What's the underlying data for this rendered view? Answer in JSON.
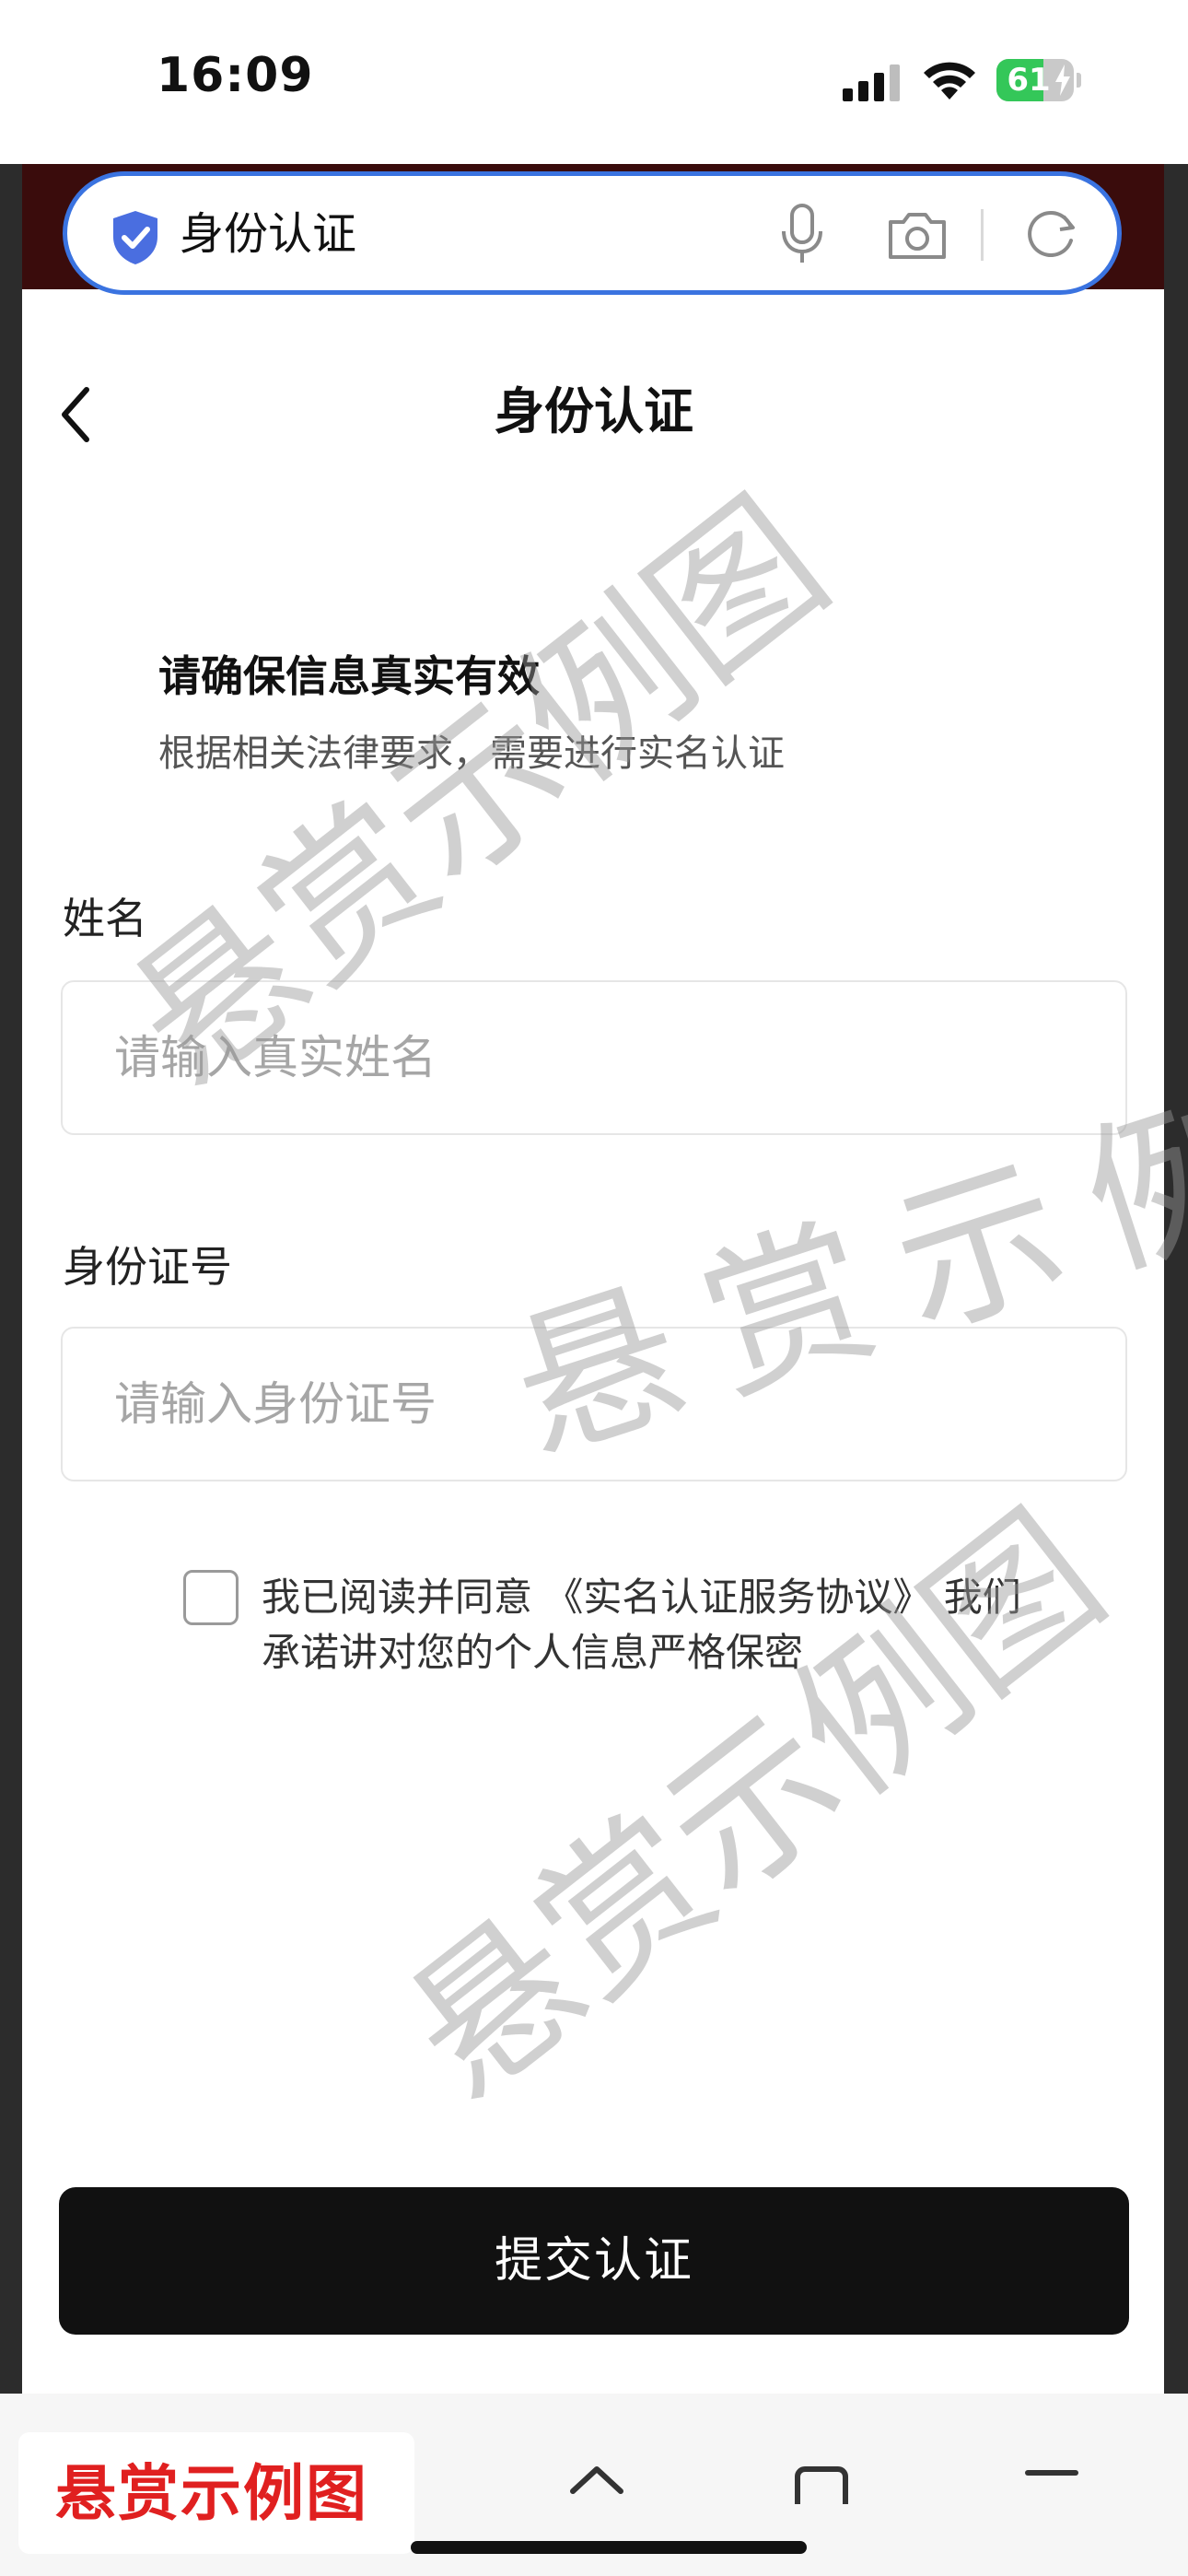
{
  "status_bar": {
    "time": "16:09",
    "battery_level": 61,
    "battery_text": "61",
    "battery_color": "#34c759"
  },
  "browser": {
    "search_text": "身份认证",
    "accent_color": "#3a73e0",
    "icons": [
      "shield-check-icon",
      "mic-icon",
      "camera-icon",
      "refresh-icon"
    ]
  },
  "page": {
    "title": "身份认证",
    "headline": "请确保信息真实有效",
    "subline": "根据相关法律要求，需要进行实名认证"
  },
  "form": {
    "name_label": "姓名",
    "name_placeholder": "请输入真实姓名",
    "name_value": "",
    "id_label": "身份证号",
    "id_placeholder": "请输入身份证号",
    "id_value": "",
    "agree_prefix": "我已阅读并同意 ",
    "agree_link": "《实名认证服务协议》",
    "agree_suffix": " 我们",
    "agree_line2": "承诺讲对您的个人信息严格保密",
    "agreed": false,
    "submit_label": "提交认证"
  },
  "watermark": {
    "text": "悬赏示例图",
    "brand_text": "悬赏示例图",
    "brand_color": "#e02020"
  }
}
